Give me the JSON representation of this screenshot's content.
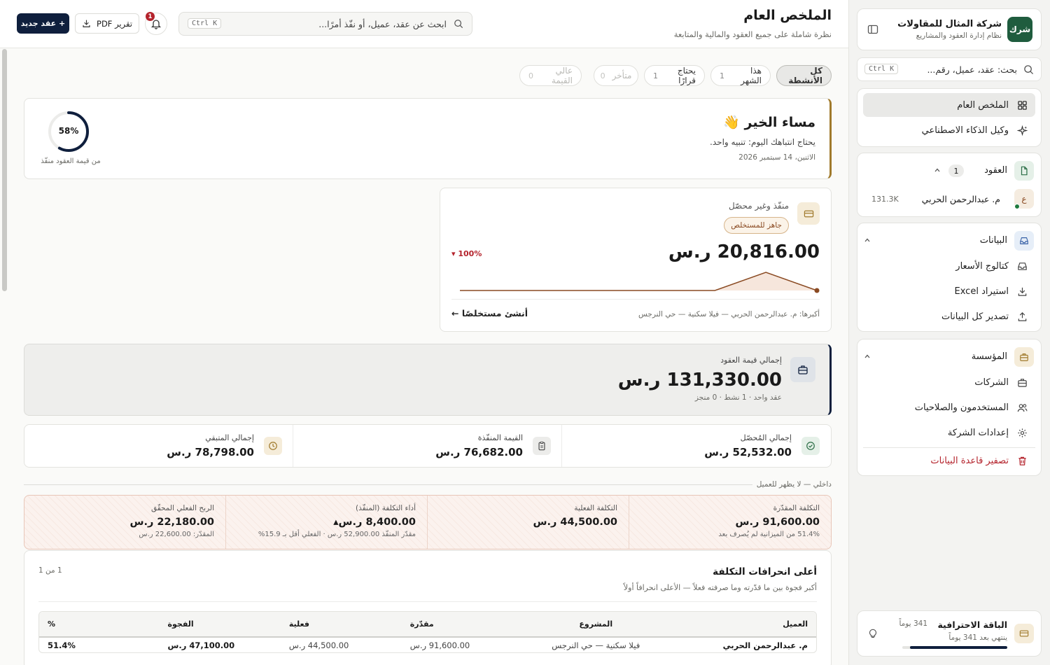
{
  "sidebar": {
    "company": {
      "logo_text": "شرك",
      "name": "شركة المثال للمقاولات",
      "subtitle": "نظام إدارة العقود والمشاريع"
    },
    "search": {
      "placeholder": "بحث: عقد، عميل، رقم...",
      "shortcut": "Ctrl K"
    },
    "nav": [
      {
        "label": "الملخص العام",
        "icon": "dashboard-grid-icon"
      },
      {
        "label": "وكيل الذكاء الاصطناعي",
        "icon": "sparkle-icon"
      }
    ],
    "contracts": {
      "title": "العقود",
      "count": "1",
      "client_initial": "ع",
      "client_name": "م. عبدالرحمن الحربي",
      "client_value": "131.3K"
    },
    "data_section": {
      "title": "البيانات",
      "items": [
        "كتالوج الأسعار",
        "استيراد Excel",
        "تصدير كل البيانات"
      ]
    },
    "org_section": {
      "title": "المؤسسة",
      "items": [
        "الشركات",
        "المستخدمون والصلاحيات",
        "إعدادات الشركة"
      ],
      "danger": "تصفير قاعدة البيانات"
    },
    "plan": {
      "title": "الباقة الاحترافية",
      "subtitle": "ينتهي بعد 341 يوماً",
      "days": "341 يوماً",
      "progress_pct": 93
    }
  },
  "header": {
    "title": "الملخص العام",
    "subtitle": "نظرة شاملة على جميع العقود والمالية والمتابعة",
    "search_placeholder": "ابحث عن عقد، عميل، أو نفّذ أمرًا...",
    "search_shortcut": "Ctrl K",
    "notif_count": "1",
    "pdf_label": "تقرير PDF",
    "new_label": "+ عقد جديد"
  },
  "filters": [
    {
      "label": "كل الأنشطة",
      "count": "",
      "state": "selected"
    },
    {
      "label": "هذا الشهر",
      "count": "1",
      "state": "normal"
    },
    {
      "label": "يحتاج قرارًا",
      "count": "1",
      "state": "normal"
    },
    {
      "label": "متأخر",
      "count": "0",
      "state": "disabled"
    },
    {
      "label": "عالي القيمة",
      "count": "0",
      "state": "disabled"
    }
  ],
  "greeting": {
    "title": "مساء الخير 👋",
    "message": "يحتاج انتباهك اليوم: تنبيه واحد.",
    "date": "الاثنين، 14 سبتمبر 2026",
    "ring_value": "58%",
    "ring_pct": 58,
    "ring_caption": "من قيمة العقود منفّذ"
  },
  "executed_card": {
    "title": "منفّذ وغير محصّل",
    "badge": "جاهز للمستخلص",
    "amount": "20,816.00 ر.س",
    "change": "100% ▾",
    "largest": "أكبرها: م. عبدالرحمن الحربي — فيلا سكنية — حي النرجس",
    "action": "أنشئ مستخلصًا ←",
    "spark": [
      0,
      0,
      0,
      0,
      0,
      0,
      1,
      0
    ]
  },
  "total_card": {
    "title": "إجمالي قيمة العقود",
    "amount": "131,330.00 ر.س",
    "meta": "عقد واحد · 1 نشط · 0 منجز"
  },
  "stats": [
    {
      "label": "إجمالي المُحصّل",
      "value": "52,532.00 ر.س",
      "icon": "check-circle-icon"
    },
    {
      "label": "القيمة المنفّذة",
      "value": "76,682.00 ر.س",
      "icon": "clipboard-icon"
    },
    {
      "label": "إجمالي المتبقي",
      "value": "78,798.00 ر.س",
      "icon": "clock-icon"
    }
  ],
  "internal": {
    "label": "داخلي — لا يظهر للعميل",
    "cells": [
      {
        "label": "التكلفة المقدّرة",
        "value": "91,600.00 ر.س",
        "sub": "51.4% من الميزانية لم يُصرف بعد"
      },
      {
        "label": "التكلفة الفعلية",
        "value": "44,500.00 ر.س",
        "sub": ""
      },
      {
        "label": "أداء التكلفة (المنفّذ)",
        "value": "8,400.00 ر.س▴",
        "sub": "مقدّر المنفّذ 52,900.00 ر.س · الفعلي أقل بـ 15.9%"
      },
      {
        "label": "الربح الفعلي المحقّق",
        "value": "22,180.00 ر.س",
        "sub": "المقدّر: 22,600.00 ر.س"
      }
    ]
  },
  "deviations": {
    "title": "أعلى انحرافات التكلفة",
    "subtitle": "أكبر فجوة بين ما قدّرته وما صرفته فعلاً — الأعلى انحرافاً أولاً",
    "pager": "1 من 1",
    "columns": [
      "العميل",
      "المشروع",
      "مقدّرة",
      "فعلية",
      "الفجوة",
      "%"
    ],
    "rows": [
      [
        "م. عبدالرحمن الحربي",
        "فيلا سكنية — حي النرجس",
        "91,600.00 ر.س",
        "44,500.00 ر.س",
        "47,100.00 ر.س",
        "51.4%"
      ]
    ]
  },
  "colors": {
    "navy": "#0f1f3d",
    "green": "#1f5c3e",
    "brown": "#8a4a22",
    "accent_gold": "#a07a2c",
    "danger": "#b4232c"
  }
}
